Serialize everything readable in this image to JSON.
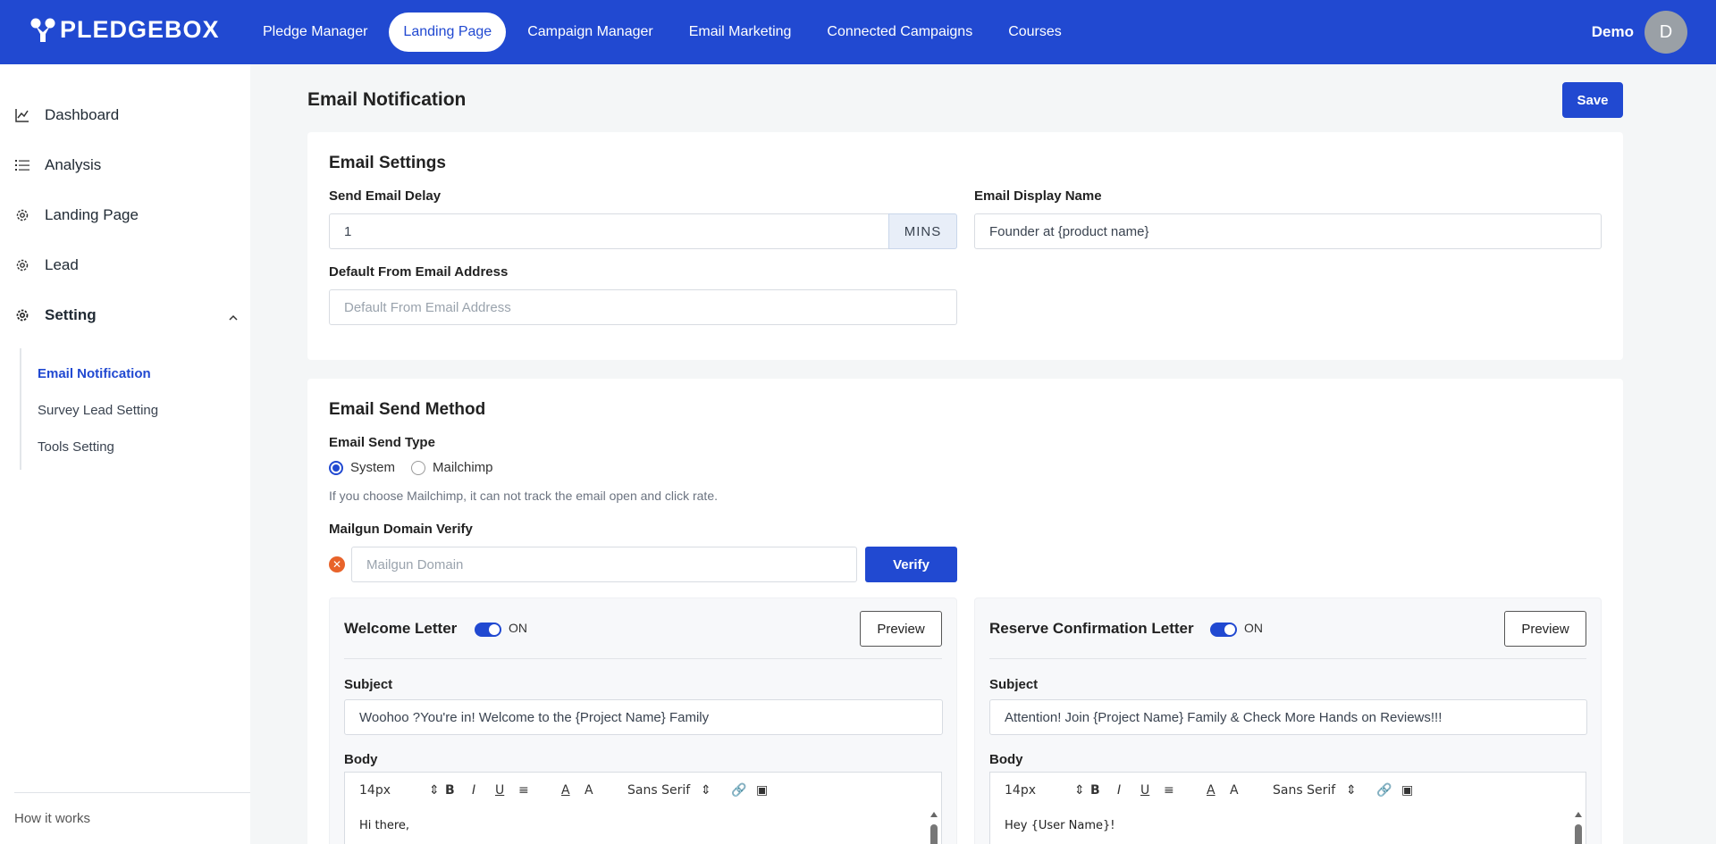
{
  "brand": {
    "name": "PLEDGEBOX"
  },
  "nav": {
    "items": [
      {
        "label": "Pledge Manager"
      },
      {
        "label": "Landing Page",
        "active": true
      },
      {
        "label": "Campaign Manager"
      },
      {
        "label": "Email Marketing"
      },
      {
        "label": "Connected Campaigns"
      },
      {
        "label": "Courses"
      }
    ]
  },
  "user": {
    "name": "Demo",
    "initial": "D"
  },
  "sidebar": {
    "items": [
      {
        "label": "Dashboard",
        "icon": "chart-line-icon"
      },
      {
        "label": "Analysis",
        "icon": "list-icon"
      },
      {
        "label": "Landing Page",
        "icon": "gear-icon"
      },
      {
        "label": "Lead",
        "icon": "gear-icon"
      },
      {
        "label": "Setting",
        "icon": "gear-icon",
        "expanded": true
      }
    ],
    "submenu": [
      {
        "label": "Email Notification",
        "active": true
      },
      {
        "label": "Survey Lead Setting"
      },
      {
        "label": "Tools Setting"
      }
    ],
    "footer": "How it works"
  },
  "page": {
    "title": "Email Notification",
    "save_label": "Save"
  },
  "email_settings": {
    "title": "Email Settings",
    "delay_label": "Send Email Delay",
    "delay_value": "1",
    "delay_unit": "MINS",
    "display_name_label": "Email Display Name",
    "display_name_value": "Founder at {product name}",
    "from_label": "Default From Email Address",
    "from_placeholder": "Default From Email Address"
  },
  "send_method": {
    "title": "Email Send Method",
    "type_label": "Email Send Type",
    "options": [
      {
        "label": "System",
        "selected": true
      },
      {
        "label": "Mailchimp",
        "selected": false
      }
    ],
    "hint": "If you choose Mailchimp, it can not track the email open and click rate.",
    "domain_label": "Mailgun Domain Verify",
    "domain_placeholder": "Mailgun Domain",
    "verify_label": "Verify"
  },
  "letters": [
    {
      "title": "Welcome Letter",
      "toggle": "ON",
      "preview_label": "Preview",
      "subject_label": "Subject",
      "subject_value": "Woohoo ?You're in! Welcome to the {Project Name} Family",
      "body_label": "Body",
      "font_size": "14px",
      "font_family": "Sans Serif",
      "body_text": "Hi there,"
    },
    {
      "title": "Reserve Confirmation Letter",
      "toggle": "ON",
      "preview_label": "Preview",
      "subject_label": "Subject",
      "subject_value": "Attention! Join  {Project Name}  Family & Check More Hands on Reviews!!!",
      "body_label": "Body",
      "font_size": "14px",
      "font_family": "Sans Serif",
      "body_text": "Hey {User Name}!"
    }
  ],
  "colors": {
    "primary": "#2149d1",
    "error": "#e8632a"
  }
}
